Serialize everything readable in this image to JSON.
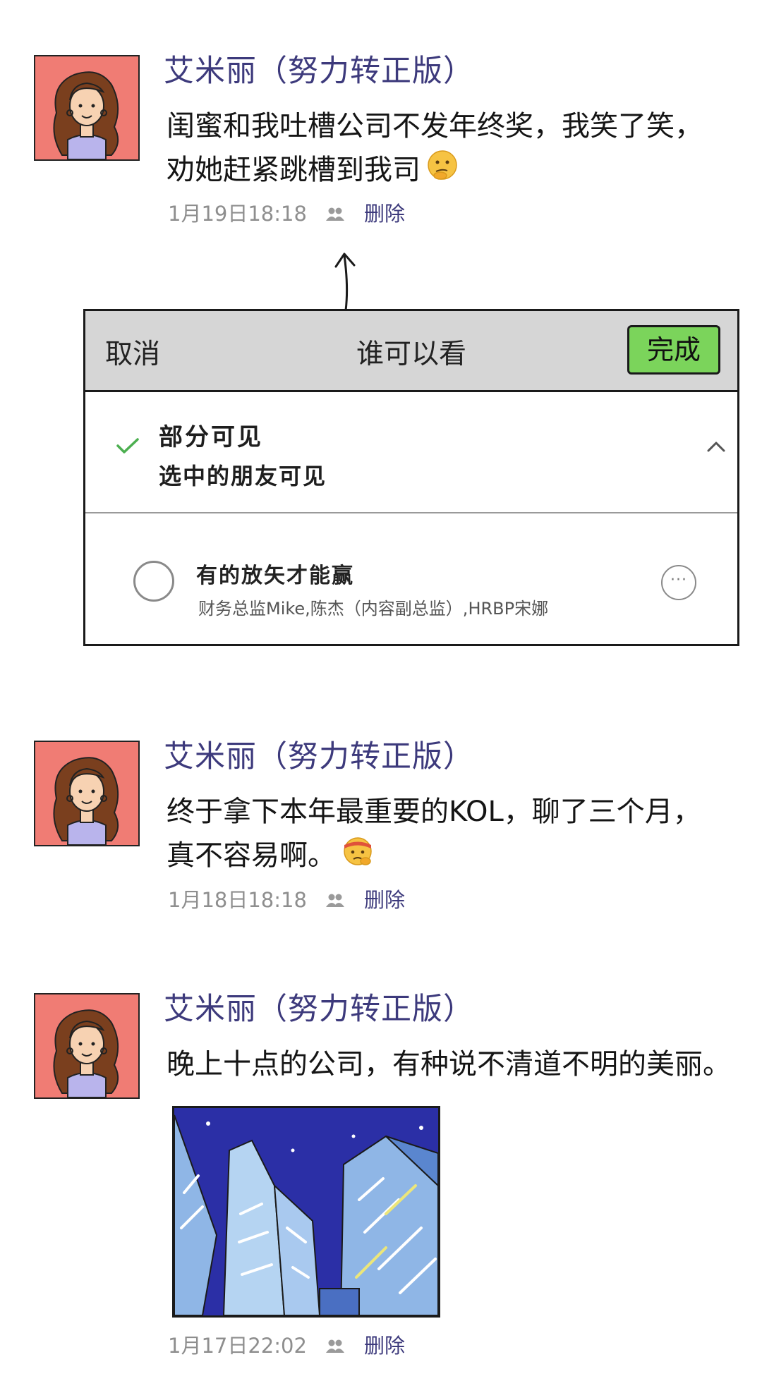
{
  "posts": [
    {
      "author": "艾米丽（努力转正版）",
      "text_lines": [
        "闺蜜和我吐槽公司不发年终奖，我笑了笑，",
        "劝她赶紧跳槽到我司"
      ],
      "emoji": "thinking-face",
      "time": "1月19日18:18",
      "delete_label": "删除"
    },
    {
      "author": "艾米丽（努力转正版）",
      "text_lines": [
        "终于拿下本年最重要的KOL，聊了三个月，",
        "真不容易啊。"
      ],
      "emoji": "headband-face",
      "time": "1月18日18:18",
      "delete_label": "删除"
    },
    {
      "author": "艾米丽（努力转正版）",
      "text_lines": [
        "晚上十点的公司，有种说不清道不明的美丽。"
      ],
      "image": "night-office-buildings",
      "time": "1月17日22:02",
      "delete_label": "删除"
    }
  ],
  "privacy_panel": {
    "cancel_label": "取消",
    "title": "谁可以看",
    "done_label": "完成",
    "option": {
      "title": "部分可见",
      "subtitle": "选中的朋友可见",
      "selected": true
    },
    "group": {
      "name": "有的放矢才能赢",
      "members": "财务总监Mike,陈杰（内容副总监）,HRBP宋娜",
      "more_label": "···"
    }
  },
  "colors": {
    "author": "#3d3a7c",
    "time": "#8e8e8e",
    "done_button": "#7bd45b",
    "panel_header": "#d6d6d6",
    "avatar_bg": "#f07c74"
  }
}
